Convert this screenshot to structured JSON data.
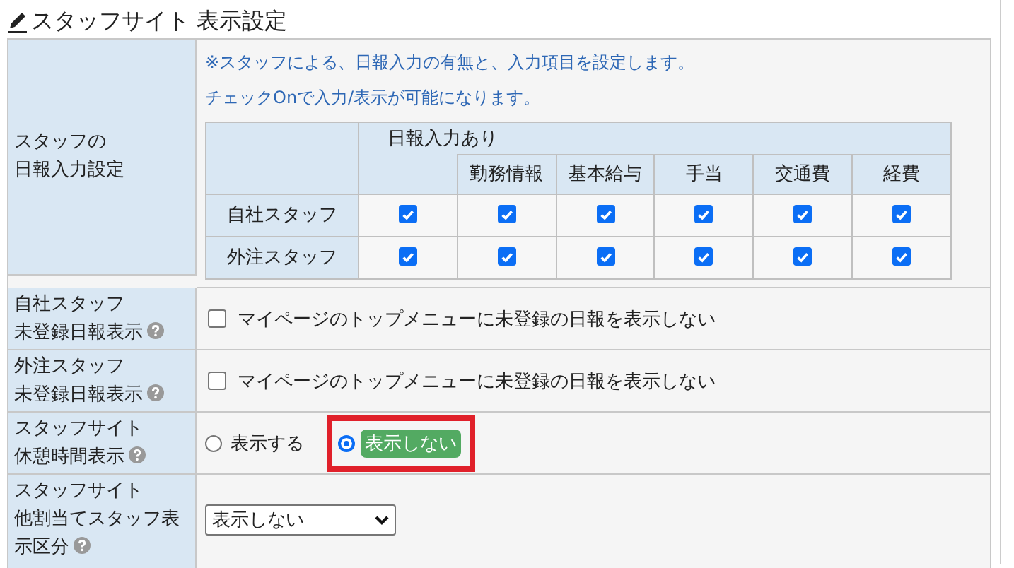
{
  "title": "スタッフサイト 表示設定",
  "settings": [
    {
      "kind": "matrix",
      "label": [
        "スタッフの",
        "日報入力設定"
      ],
      "help": false,
      "note": [
        "※スタッフによる、日報入力の有無と、入力項目を設定します。",
        "チェックOnで入力/表示が可能になります。"
      ],
      "group_header": "日報入力あり",
      "columns": [
        "勤務情報",
        "基本給与",
        "手当",
        "交通費",
        "経費"
      ],
      "rows": [
        {
          "label": "自社スタッフ",
          "cells": [
            {
              "checked": true
            },
            {
              "checked": true
            },
            {
              "checked": true
            },
            {
              "checked": true
            },
            {
              "checked": true
            },
            {
              "checked": true
            }
          ]
        },
        {
          "label": "外注スタッフ",
          "cells": [
            {
              "checked": true
            },
            {
              "checked": true
            },
            {
              "checked": true
            },
            {
              "checked": true
            },
            {
              "checked": true
            },
            {
              "checked": true
            }
          ]
        }
      ]
    },
    {
      "kind": "checkbox",
      "label": [
        "自社スタッフ",
        "未登録日報表示"
      ],
      "help": true,
      "checked": false,
      "text": "マイページのトップメニューに未登録の日報を表示しない"
    },
    {
      "kind": "checkbox",
      "label": [
        "外注スタッフ",
        "未登録日報表示"
      ],
      "help": true,
      "checked": false,
      "text": "マイページのトップメニューに未登録の日報を表示しない"
    },
    {
      "kind": "radio",
      "label": [
        "スタッフサイト",
        "休憩時間表示"
      ],
      "help": true,
      "options": [
        {
          "label": "表示する",
          "selected": false,
          "highlighted": false
        },
        {
          "label": "表示しない",
          "selected": true,
          "highlighted": true
        }
      ]
    },
    {
      "kind": "select",
      "label": [
        "スタッフサイト",
        "他割当てスタッフ表示区分"
      ],
      "help": true,
      "value": "表示しない"
    }
  ]
}
